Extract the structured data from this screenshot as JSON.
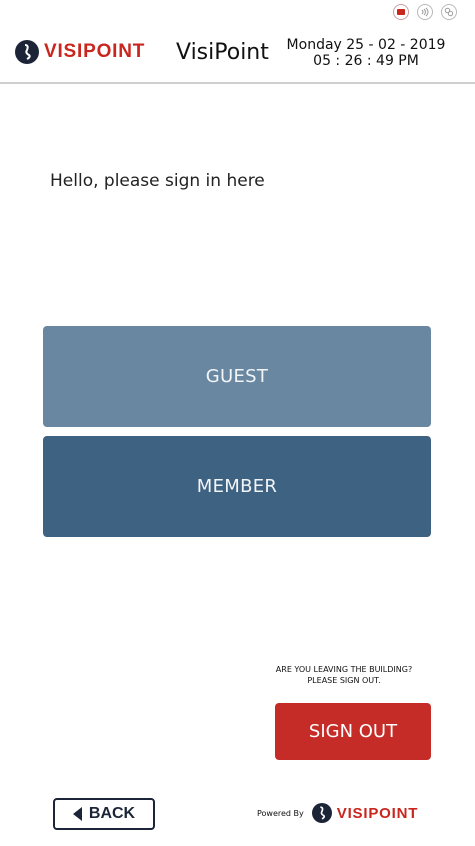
{
  "status_icons": [
    "record-icon",
    "contactless-icon",
    "link-icon"
  ],
  "header": {
    "brand": "VISIPOINT",
    "app_name": "VisiPoint",
    "date": "Monday 25 - 02 - 2019",
    "time": "05 : 26 : 49  PM"
  },
  "main": {
    "greeting": "Hello, please sign in here",
    "guest_label": "GUEST",
    "member_label": "MEMBER"
  },
  "signout": {
    "note_line1": "ARE YOU LEAVING THE BUILDING?",
    "note_line2": "PLEASE SIGN OUT.",
    "button_label": "SIGN OUT"
  },
  "footer": {
    "back_label": "BACK",
    "powered_by": "Powered By",
    "brand": "VISIPOINT"
  },
  "colors": {
    "brand_red": "#c8261e",
    "guest_tile": "#6987a0",
    "member_tile": "#3e6282",
    "signout_button": "#c62c27",
    "dark_navy": "#1c2538"
  }
}
